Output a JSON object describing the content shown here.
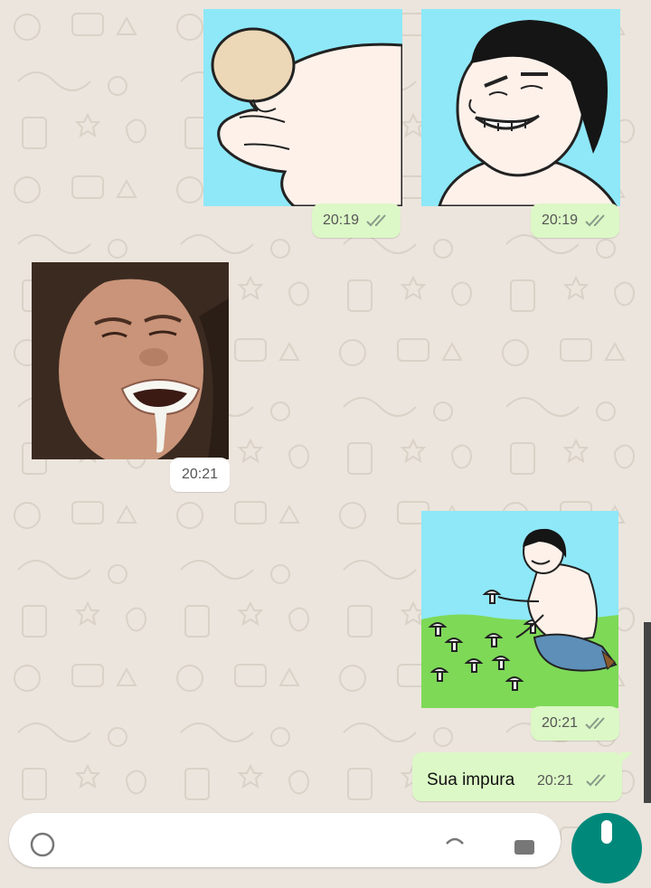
{
  "messages": [
    {
      "type": "sticker",
      "direction": "outgoing",
      "sticker": "hand-holding-mushroom-sticker",
      "time": "20:19",
      "status": "read"
    },
    {
      "type": "sticker",
      "direction": "outgoing",
      "sticker": "rage-comic-grin-face-sticker",
      "time": "20:19",
      "status": "read"
    },
    {
      "type": "sticker",
      "direction": "incoming",
      "sticker": "girl-crying-photo-sticker",
      "time": "20:21"
    },
    {
      "type": "sticker",
      "direction": "outgoing",
      "sticker": "man-picking-mushrooms-sticker",
      "time": "20:21",
      "status": "read"
    },
    {
      "type": "text",
      "direction": "outgoing",
      "text": "Sua impura",
      "time": "20:21",
      "status": "read"
    }
  ],
  "icons": {
    "read_receipt": "double-check-icon",
    "emoji": "emoji-icon",
    "attach": "attach-icon",
    "camera": "camera-icon",
    "mic": "mic-icon"
  },
  "colors": {
    "wallpaper": "#ece5dd",
    "outgoing_bubble": "#dcf8c6",
    "incoming_bubble": "#ffffff",
    "sticker_sky": "#8ee8f8",
    "mic_button": "#00897b",
    "read_receipt": "#8a9a8a"
  }
}
